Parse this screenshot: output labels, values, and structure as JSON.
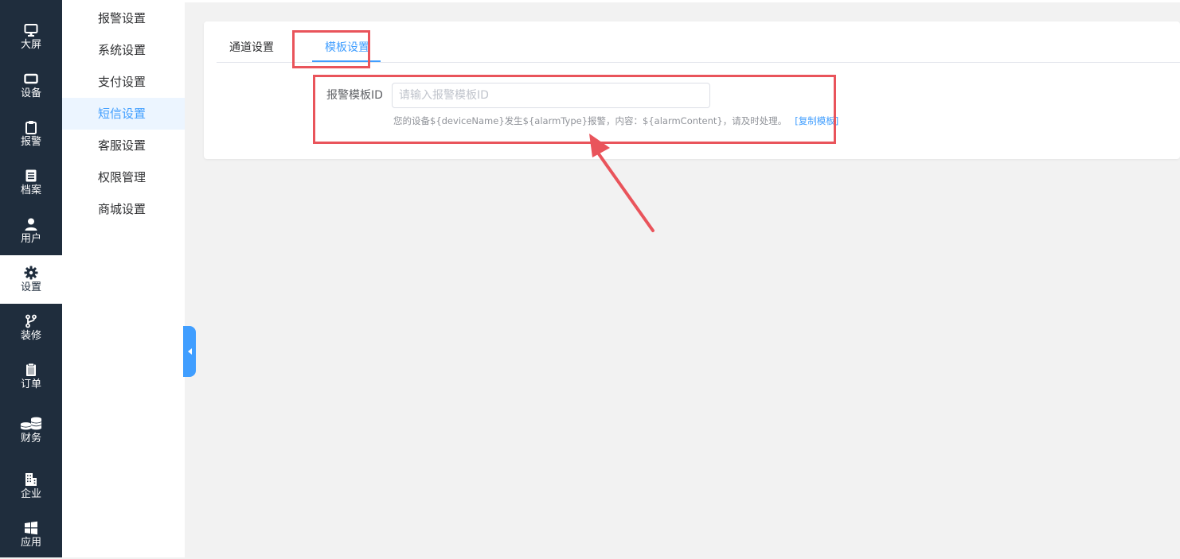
{
  "nav": {
    "items": [
      {
        "label": "大屏",
        "icon": "monitor-icon"
      },
      {
        "label": "设备",
        "icon": "device-icon"
      },
      {
        "label": "报警",
        "icon": "clipboard-icon"
      },
      {
        "label": "档案",
        "icon": "file-icon"
      },
      {
        "label": "用户",
        "icon": "user-icon"
      },
      {
        "label": "设置",
        "icon": "gear-icon"
      },
      {
        "label": "装修",
        "icon": "branch-icon"
      },
      {
        "label": "订单",
        "icon": "order-icon"
      },
      {
        "label": "财务",
        "icon": "coins-icon"
      },
      {
        "label": "企业",
        "icon": "building-icon"
      },
      {
        "label": "应用",
        "icon": "windows-icon"
      }
    ],
    "active_index": 5
  },
  "submenu": {
    "items": [
      {
        "label": "报警设置"
      },
      {
        "label": "系统设置"
      },
      {
        "label": "支付设置"
      },
      {
        "label": "短信设置"
      },
      {
        "label": "客服设置"
      },
      {
        "label": "权限管理"
      },
      {
        "label": "商城设置"
      }
    ],
    "active_index": 3
  },
  "tabs": [
    {
      "label": "通道设置",
      "active": false
    },
    {
      "label": "模板设置",
      "active": true
    }
  ],
  "form": {
    "label": "报警模板ID",
    "value": "",
    "placeholder": "请输入报警模板ID",
    "hint": "您的设备${deviceName}发生${alarmType}报警，内容：${alarmContent}，请及时处理。",
    "copy_link": "[复制模板]"
  },
  "colors": {
    "nav_bg": "#1f2d3d",
    "accent": "#409eff",
    "annotation": "#e9545b",
    "page_bg": "#f2f2f2"
  }
}
